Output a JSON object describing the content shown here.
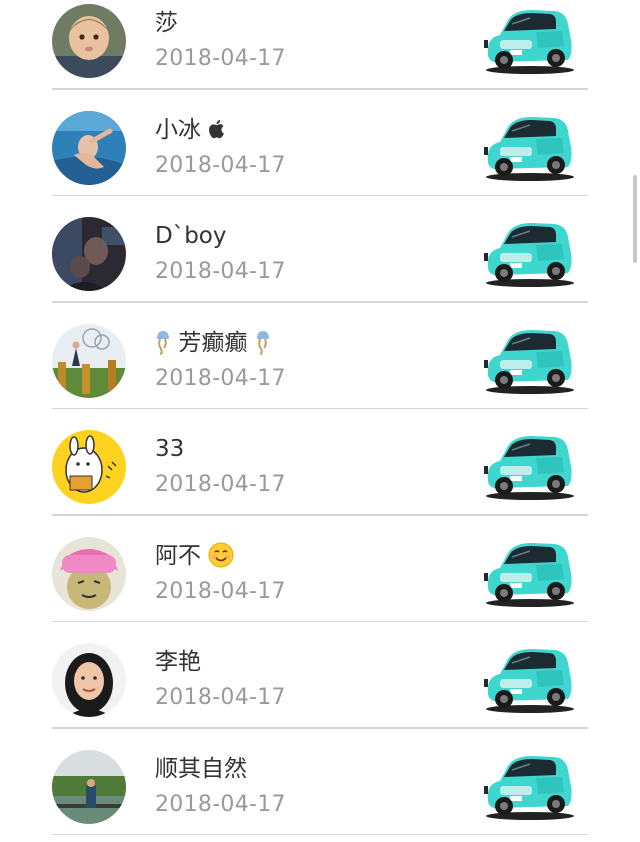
{
  "colors": {
    "name_text": "#333333",
    "date_text": "#9a9a9a",
    "divider": "#d6d6d6",
    "car_body": "#3ed6cf",
    "scrollbar": "#c8c8c8"
  },
  "list": {
    "items": [
      {
        "name": "莎",
        "date": "2018-04-17",
        "avatar_icon": "baby-portrait-avatar",
        "trailing_icon": "teal-car-icon"
      },
      {
        "name": "小冰",
        "name_suffix_icon": "apple-logo-icon",
        "date": "2018-04-17",
        "avatar_icon": "swimming-baby-avatar",
        "trailing_icon": "teal-car-icon"
      },
      {
        "name": "D`boy",
        "date": "2018-04-17",
        "avatar_icon": "dark-photo-avatar",
        "trailing_icon": "teal-car-icon"
      },
      {
        "name": "芳癫癫",
        "name_prefix_icon": "jellyfish-emoji-icon",
        "name_suffix_icon": "jellyfish-emoji-icon",
        "date": "2018-04-17",
        "avatar_icon": "garden-photo-avatar",
        "trailing_icon": "teal-car-icon"
      },
      {
        "name": "33",
        "date": "2018-04-17",
        "avatar_icon": "cartoon-bunny-avatar",
        "trailing_icon": "teal-car-icon"
      },
      {
        "name": "阿不",
        "name_suffix_icon": "smiling-face-emoji-icon",
        "date": "2018-04-17",
        "avatar_icon": "meme-face-avatar",
        "trailing_icon": "teal-car-icon"
      },
      {
        "name": "李艳",
        "date": "2018-04-17",
        "avatar_icon": "woman-portrait-avatar",
        "trailing_icon": "teal-car-icon"
      },
      {
        "name": "顺其自然",
        "date": "2018-04-17",
        "avatar_icon": "lakeside-photo-avatar",
        "trailing_icon": "teal-car-icon"
      }
    ]
  }
}
